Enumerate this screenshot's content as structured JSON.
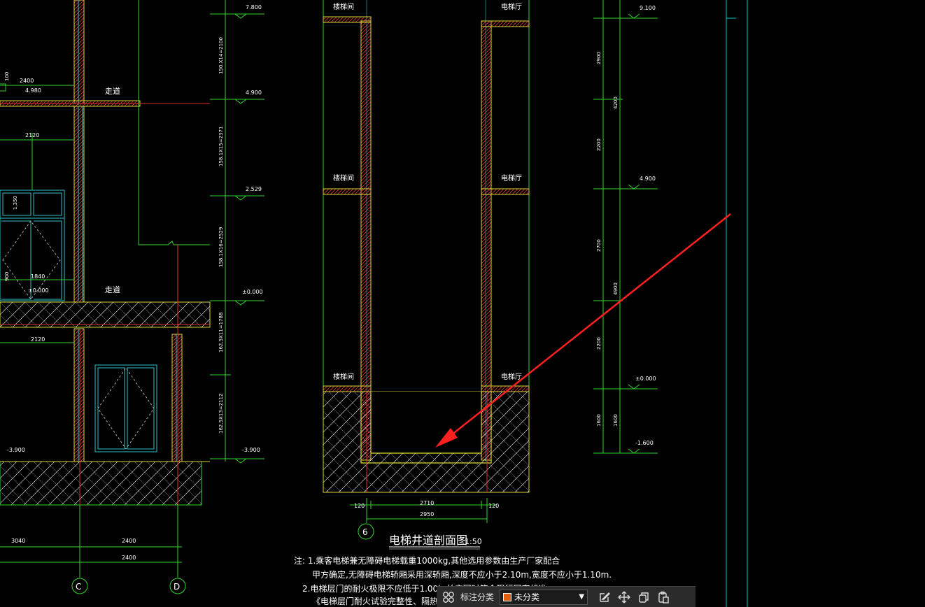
{
  "colors": {
    "background": "#000000",
    "wall": "#d9d93a",
    "hatch": "#ffffff",
    "dim": "#31d431",
    "axis": "#e03030",
    "door": "#2ec4c4",
    "arrow": "#ff2020",
    "grid": "#14c4c4",
    "category_swatch": "#e06010"
  },
  "left_section": {
    "labels": {
      "corridor_upper": "走道",
      "corridor_lower": "走道",
      "dim_2400_top": "2400",
      "dim_2120_a": "2120",
      "dim_2120_b": "2120",
      "dim_1840": "1840",
      "dim_450": "1,350",
      "dim_900": "900",
      "dim_100": "100",
      "elev_4980": "4.980",
      "elev_000": "±0.000",
      "elev_m3900": "-3.900",
      "dim_3040": "3040",
      "dim_2400_b": "2400",
      "dim_2400_c": "2400",
      "axis_c": "C",
      "axis_d": "D"
    },
    "elevations": {
      "e7": "7.800",
      "e4": "4.900",
      "e2": "2.529",
      "e0": "±0.000",
      "em": "-3.900"
    },
    "vertical_dims": {
      "v1": "150.X14=2100",
      "v2": "158.1X15=2371",
      "v3": "158.1X16=2529",
      "v4": "162.5X11=1788",
      "v5": "162.5X13=2112"
    }
  },
  "middle_section": {
    "rooms": {
      "stair_1": "楼梯间",
      "stair_2": "楼梯间",
      "stair_3": "楼梯间",
      "hall_1": "电梯厅",
      "hall_2": "电梯厅",
      "hall_3": "电梯厅"
    },
    "dims": {
      "left_wall": "120",
      "inner": "2710",
      "right_wall": "120",
      "total": "2950"
    },
    "callout_number": "6",
    "title": "电梯井道剖面图",
    "scale": "1:50"
  },
  "right_section": {
    "elevations": {
      "e9": "9.100",
      "e4": "4.900",
      "e0": "±0.000",
      "em": "-1.600"
    },
    "dims": {
      "d2900": "2900",
      "d2200a": "2200",
      "d4200": "4200",
      "d2700": "2700",
      "d2200b": "2200",
      "d4900": "4900",
      "d1600a": "1600",
      "d1600b": "1600"
    }
  },
  "notes": {
    "line1": "注: 1.乘客电梯兼无障碍电梯载重1000kg,其他选用参数由生产厂家配合",
    "line2": "甲方确定,无障碍电梯轿厢采用深轿厢,深度不应小于2.10m,宽度不应小于1.10m.",
    "line3": "2.电梯层门的耐火极限不应低于1.00h,并应同时符合现行国家标准",
    "line4": "《电梯层门耐火试验完整性、隔热性和"
  },
  "toolbar": {
    "grid_icon": "grid-icon",
    "label": "标注分类",
    "category_value": "未分类",
    "edit_icon": "edit-icon",
    "move_icon": "move-icon",
    "copy_icon": "copy-icon",
    "paste_icon": "paste-icon"
  }
}
